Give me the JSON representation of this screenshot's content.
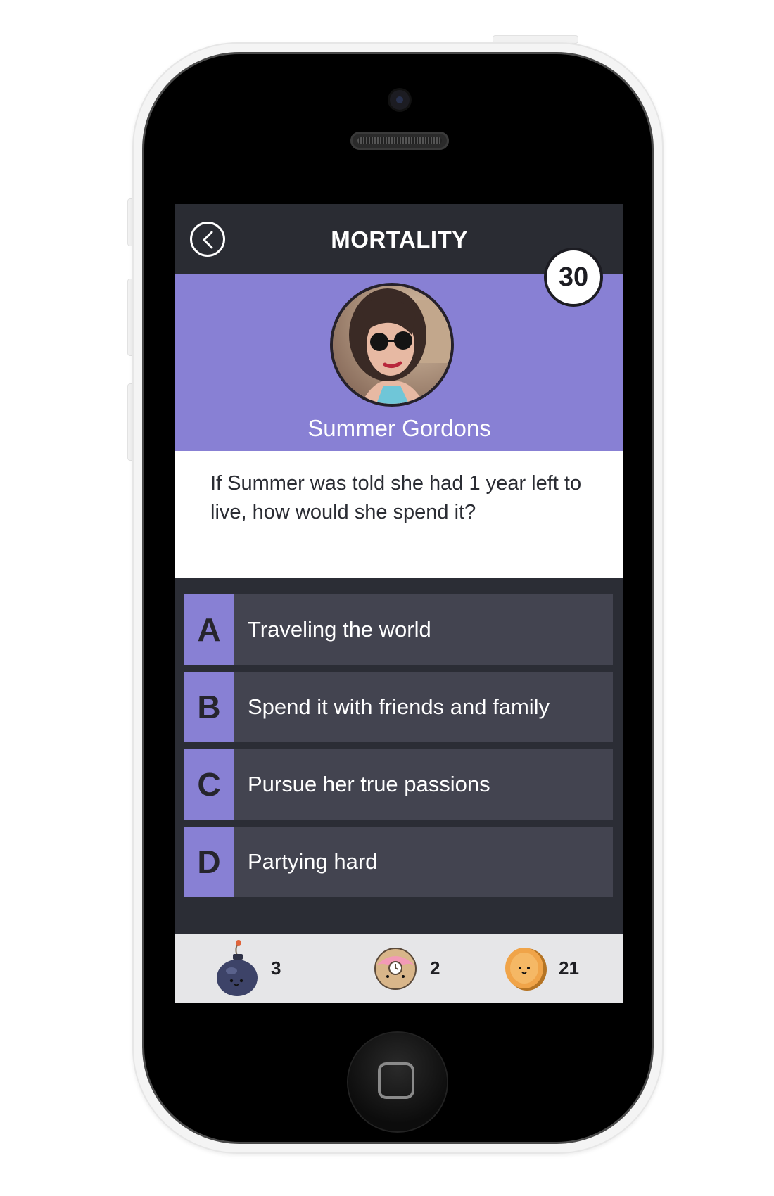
{
  "header": {
    "title": "MORTALITY",
    "back_label": "Back",
    "timer": "30"
  },
  "profile": {
    "name": "Summer Gordons"
  },
  "question": {
    "text": "If Summer was told she had 1 year left to live, how would she spend it?"
  },
  "answers": [
    {
      "letter": "A",
      "text": "Traveling the world"
    },
    {
      "letter": "B",
      "text": "Spend it with friends and family"
    },
    {
      "letter": "C",
      "text": "Pursue her true passions"
    },
    {
      "letter": "D",
      "text": "Partying hard"
    }
  ],
  "footer": {
    "bomb": {
      "icon": "bomb-icon",
      "count": "3"
    },
    "donut": {
      "icon": "donut-icon",
      "count": "2"
    },
    "coin": {
      "icon": "coin-icon",
      "count": "21"
    }
  },
  "colors": {
    "accent": "#8880d4",
    "topbar": "#2a2c33",
    "answer_bg": "#434450",
    "footer_bg": "#e6e6e8"
  }
}
